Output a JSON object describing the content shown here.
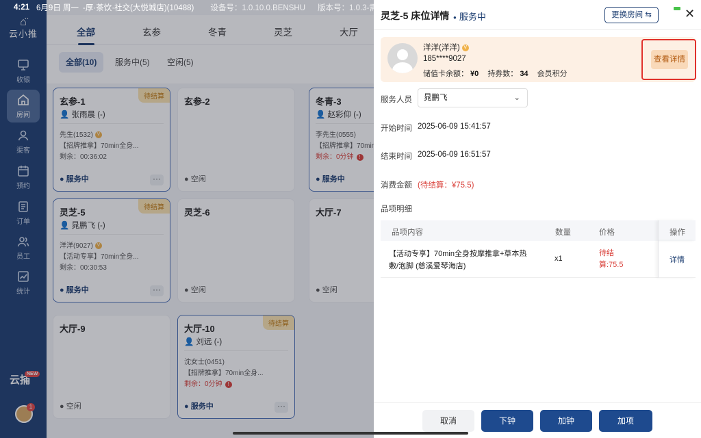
{
  "status_bar": {
    "time": "4:21",
    "date": "6月9日 周一",
    "store": "-厚·茶饮·社交(大悦城店)(10488)",
    "device": "设备号：1.0.10.0.BENSHU",
    "version": "版本号：1.0.3-需要电"
  },
  "sidebar": {
    "logo_text": "云小推",
    "items": [
      {
        "label": "收银",
        "icon": "monitor-icon"
      },
      {
        "label": "房间",
        "icon": "home-icon"
      },
      {
        "label": "渠客",
        "icon": "user-icon"
      },
      {
        "label": "预约",
        "icon": "calendar-icon"
      },
      {
        "label": "订单",
        "icon": "document-icon"
      },
      {
        "label": "员工",
        "icon": "people-icon"
      },
      {
        "label": "统计",
        "icon": "chart-icon"
      }
    ],
    "active_index": 1,
    "tag_logo": "云捕",
    "tag_new": "NEW",
    "avatar_badge": "1"
  },
  "main": {
    "tabs": [
      "全部",
      "玄参",
      "冬青",
      "灵芝",
      "大厅"
    ],
    "filters": [
      "全部(10)",
      "服务中(5)",
      "空闲(5)"
    ],
    "cards": [
      {
        "room": "玄参-1",
        "badge": "待结算",
        "staff": "张雨晨 (-)",
        "customer": "先生(1532)",
        "vip": "V",
        "item": "【招牌推拿】70min全身...",
        "remain": "剩余：00:36:02",
        "remain_red": false,
        "state": "服务中",
        "more": "···"
      },
      {
        "room": "玄参-2",
        "state": "空闲"
      },
      {
        "room": "冬青-3",
        "badge": "待结算",
        "staff": "赵彩仰 (-)",
        "customer": "李先生(0555)",
        "item": "【招牌推拿】70min全身...",
        "remain": "剩余：0分钟",
        "remain_red": true,
        "state": "服务中"
      },
      {
        "room": "灵芝-5",
        "badge": "待结算",
        "staff": "晁鹏飞 (-)",
        "customer": "洋洋(9027)",
        "vip": "V",
        "item": "【活动专享】70min全身...",
        "remain": "剩余：00:30:53",
        "remain_red": false,
        "state": "服务中",
        "more": "···"
      },
      {
        "room": "灵芝-6",
        "state": "空闲"
      },
      {
        "room": "大厅-7",
        "state": "空闲"
      },
      {
        "room": "大厅-9",
        "state": "空闲"
      },
      {
        "room": "大厅-10",
        "badge": "待结算",
        "staff": "刘远 (-)",
        "customer": "沈女士(0451)",
        "item": "【招牌推拿】70min全身...",
        "remain": "剩余：0分钟",
        "remain_red": true,
        "state": "服务中",
        "more": "···"
      }
    ]
  },
  "drawer": {
    "title": "灵芝-5 床位详情",
    "state": "服务中",
    "swap_label": "更换房间",
    "swap_icon": "⇆",
    "close": "✕",
    "member": {
      "name": "洋洋(洋洋)",
      "vip": "V",
      "phone": "185****9027",
      "balance_label": "储值卡余额：",
      "balance": "¥0",
      "coupons_label": "持券数：",
      "coupons": "34",
      "points_label": "会员积分",
      "detail_button": "查看详情"
    },
    "staff_label": "服务人员",
    "staff_value": "晁鹏飞",
    "start_label": "开始时间",
    "start_value": "2025-06-09 15:41:57",
    "end_label": "结束时间",
    "end_value": "2025-06-09 16:51:57",
    "amount_label": "消费金额",
    "amount_value": "(待结算：¥75.5)",
    "items_label": "品项明细",
    "table": {
      "headers": [
        "品项内容",
        "数量",
        "价格",
        "操作"
      ],
      "rows": [
        {
          "content_line1": "【活动专享】70min全身按摩推拿+草本热",
          "content_line2": "敷/泡脚 (慈溪爱琴海店)",
          "qty": "x1",
          "price_line1": "待结",
          "price_line2": "算:75.5",
          "action": "详情"
        }
      ]
    },
    "footer": [
      "取消",
      "下钟",
      "加钟",
      "加项"
    ]
  },
  "colors": {
    "navy": "#1e3f72",
    "accent_orange": "#f9d9b9",
    "highlight_red": "#e0312c",
    "warn_red": "#d9403a"
  }
}
